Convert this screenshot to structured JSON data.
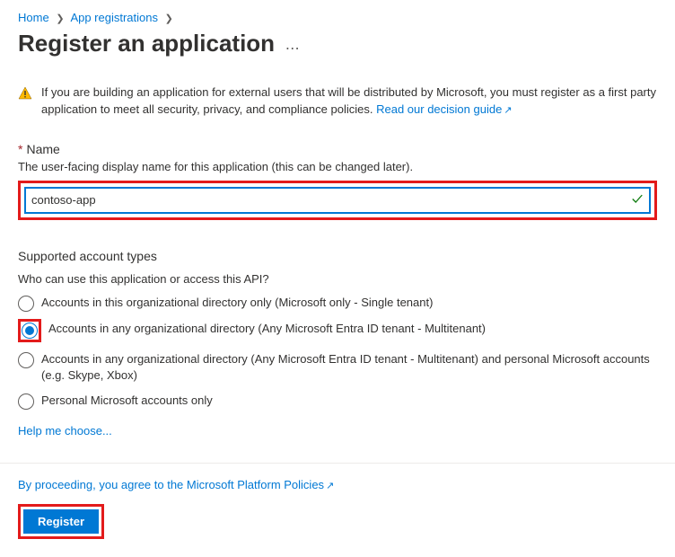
{
  "breadcrumb": {
    "home": "Home",
    "app_reg": "App registrations"
  },
  "page_title": "Register an application",
  "warning": {
    "text": "If you are building an application for external users that will be distributed by Microsoft, you must register as a first party application to meet all security, privacy, and compliance policies.",
    "link": "Read our decision guide"
  },
  "name_field": {
    "label": "Name",
    "desc": "The user-facing display name for this application (this can be changed later).",
    "value": "contoso-app"
  },
  "account_types": {
    "heading": "Supported account types",
    "question": "Who can use this application or access this API?",
    "options": [
      "Accounts in this organizational directory only (Microsoft only - Single tenant)",
      "Accounts in any organizational directory (Any Microsoft Entra ID tenant - Multitenant)",
      "Accounts in any organizational directory (Any Microsoft Entra ID tenant - Multitenant) and personal Microsoft accounts (e.g. Skype, Xbox)",
      "Personal Microsoft accounts only"
    ],
    "selected": 1,
    "help": "Help me choose..."
  },
  "policies_text": "By proceeding, you agree to the Microsoft Platform Policies",
  "register_label": "Register"
}
